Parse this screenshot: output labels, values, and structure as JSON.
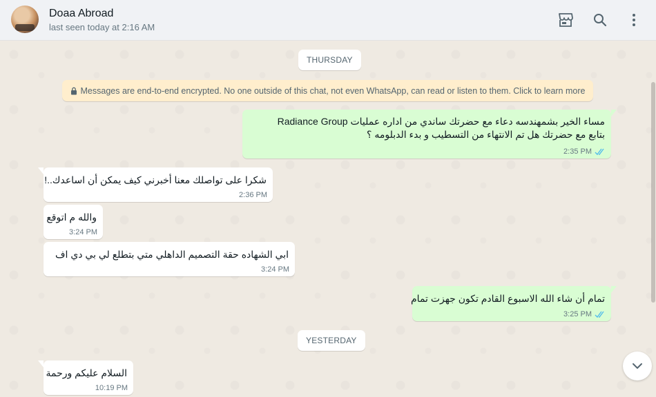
{
  "header": {
    "contact_name": "Doaa Abroad",
    "contact_status": "last seen today at 2:16 AM",
    "icons": [
      "catalog-icon",
      "search-icon",
      "menu-icon"
    ]
  },
  "dates": {
    "thursday": "THURSDAY",
    "yesterday": "YESTERDAY"
  },
  "encryption_notice": "Messages are end-to-end encrypted. No one outside of this chat, not even WhatsApp, can read or listen to them. Click to learn more",
  "messages": [
    {
      "direction": "outgoing",
      "line1": "مساء الخير بشمهندسه دعاء مع حضرتك ساندي من اداره عمليات Radiance Group",
      "line2": "بتابع مع حضرتك هل تم الانتهاء من التسطيب و بدء الدبلومه ؟",
      "time": "2:35 PM",
      "status": "read"
    },
    {
      "direction": "incoming",
      "text": "شكرا على تواصلك معنا أخبرني كيف يمكن أن اساعدك..!",
      "time": "2:36 PM"
    },
    {
      "direction": "incoming",
      "text": "والله م اتوقع",
      "time": "3:24 PM"
    },
    {
      "direction": "incoming",
      "text": "ابي الشهاده حقة التصميم الداهلي متي بتطلع لي بي دي اف",
      "time": "3:24 PM"
    },
    {
      "direction": "outgoing",
      "text": "تمام أن شاء الله الاسبوع القادم تكون جهزت تمام",
      "time": "3:25 PM",
      "status": "read"
    },
    {
      "direction": "incoming",
      "text": "السلام عليكم ورحمة",
      "time": "10:19 PM"
    }
  ],
  "colors": {
    "outgoing_bubble": "#d9fdd3",
    "incoming_bubble": "#ffffff",
    "read_ticks": "#53bdeb",
    "encryption_bg": "#ffeecd"
  }
}
